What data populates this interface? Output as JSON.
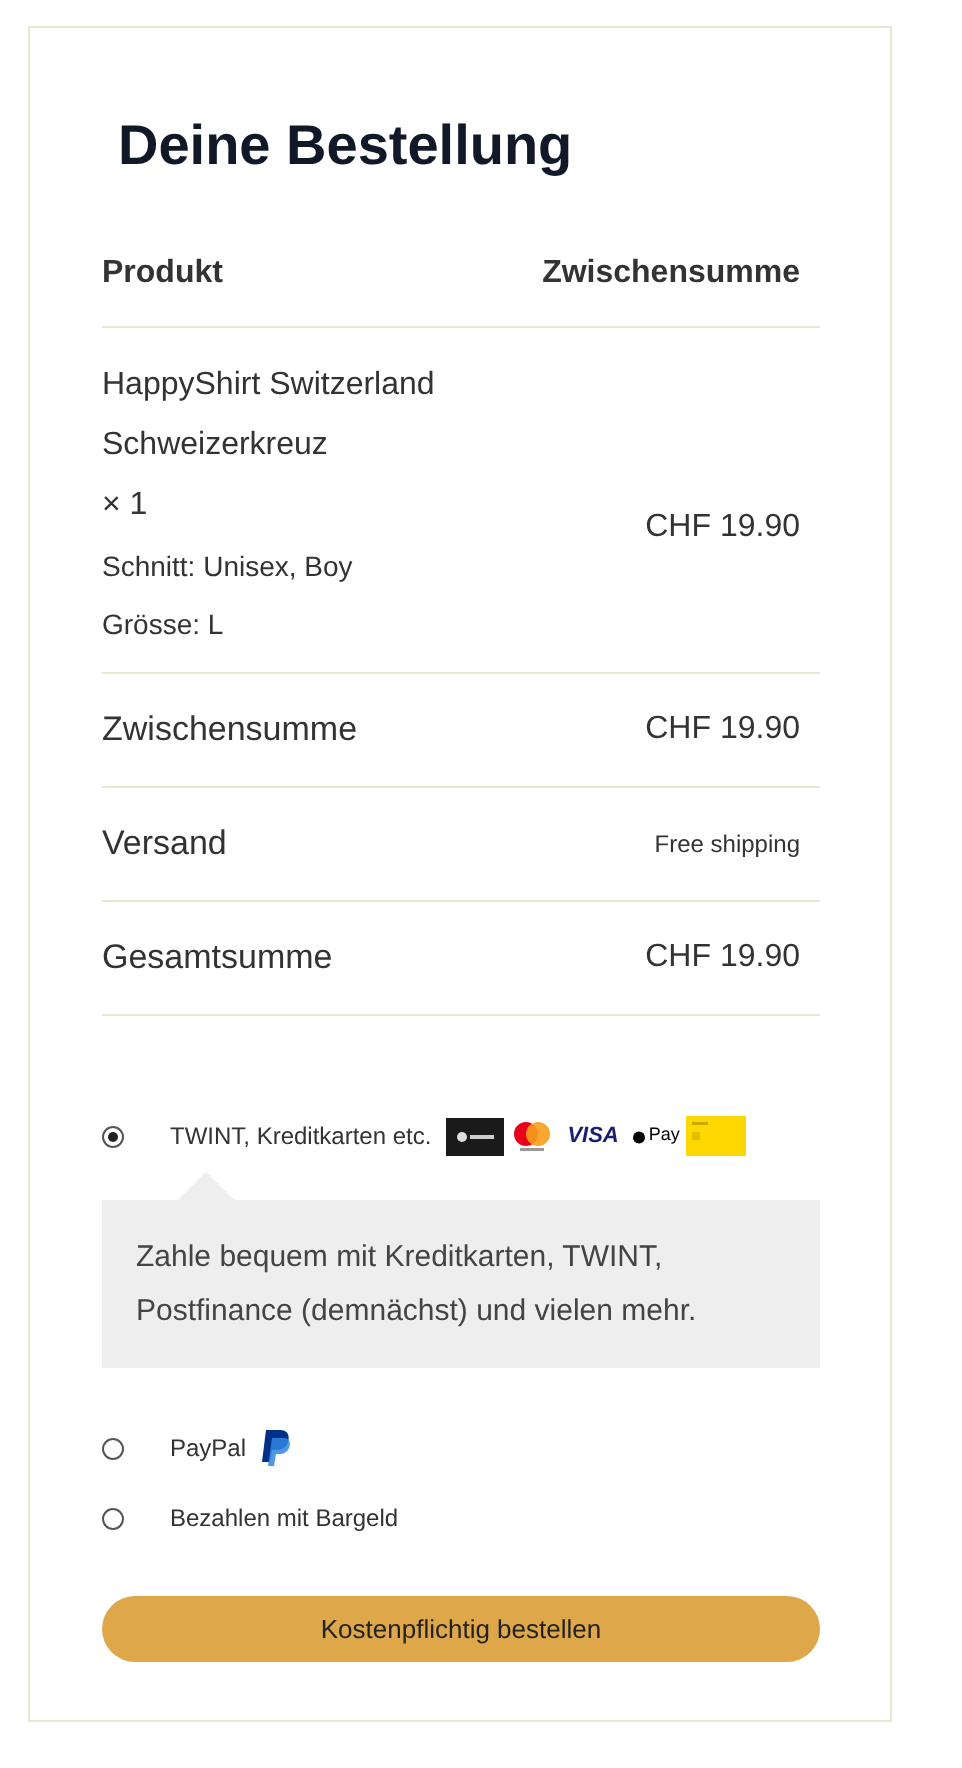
{
  "title": "Deine Bestellung",
  "columns": [
    "Produkt",
    "Zwischensumme"
  ],
  "product": {
    "name_lines": [
      "HappyShirt Switzerland",
      "Schweizerkreuz"
    ],
    "quantity": "× 1",
    "price": "CHF 19.90",
    "attributes": [
      "Schnitt: Unisex, Boy",
      "Grösse: L"
    ]
  },
  "totals": [
    {
      "label": "Zwischensumme",
      "value": "CHF 19.90",
      "kind": "amount"
    },
    {
      "label": "Versand",
      "value": "Free shipping",
      "kind": "note"
    },
    {
      "label": "Gesamtsumme",
      "value": "CHF 19.90",
      "kind": "amount"
    }
  ],
  "payment_methods": [
    {
      "label": "TWINT, Kreditkarten etc.",
      "selected": true,
      "logos": [
        {
          "kind": "twint"
        },
        {
          "kind": "mastercard"
        },
        {
          "kind": "visa",
          "label": "VISA"
        },
        {
          "kind": "applepay",
          "label": "Pay"
        },
        {
          "kind": "postcard"
        }
      ],
      "description": "Zahle bequem mit Kreditkarten, TWINT, Postfinance (demnächst) und vielen mehr."
    },
    {
      "label": "PayPal",
      "selected": false,
      "logos": [
        {
          "kind": "paypal"
        }
      ]
    },
    {
      "label": "Bezahlen mit Bargeld",
      "selected": false
    }
  ],
  "submit": "Kostenpflichtig bestellen"
}
